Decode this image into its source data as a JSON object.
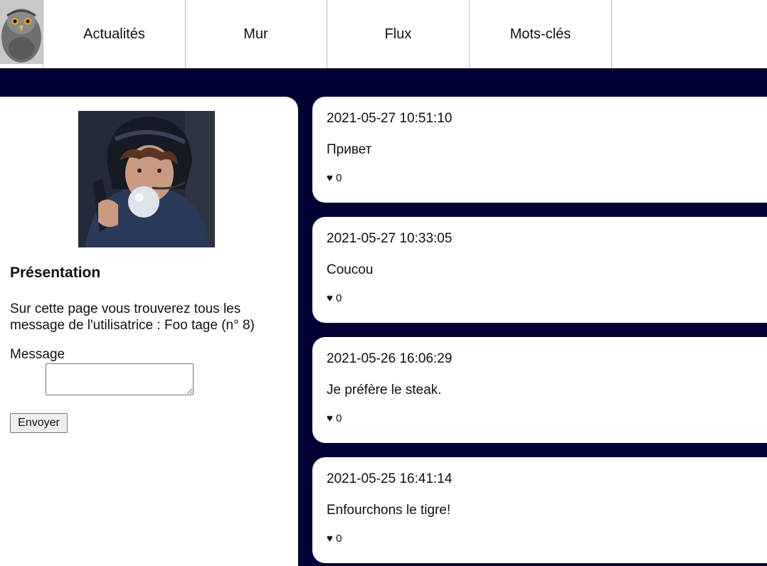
{
  "nav": {
    "items": [
      {
        "label": "Actualités"
      },
      {
        "label": "Mur"
      },
      {
        "label": "Flux"
      },
      {
        "label": "Mots-clés"
      }
    ]
  },
  "profile": {
    "title": "Présentation",
    "description": "Sur cette page vous trouverez tous les message de l'utilisatrice : Foo tage (n° 8)",
    "message_label": "Message",
    "message_value": "",
    "send_label": "Envoyer"
  },
  "posts": [
    {
      "date": "2021-05-27 10:51:10",
      "text": "Привет",
      "likes": "♥ 0"
    },
    {
      "date": "2021-05-27 10:33:05",
      "text": "Coucou",
      "likes": "♥ 0"
    },
    {
      "date": "2021-05-26 16:06:29",
      "text": "Je préfère le steak.",
      "likes": "♥ 0"
    },
    {
      "date": "2021-05-25 16:41:14",
      "text": "Enfourchons le tigre!",
      "likes": "♥ 0"
    }
  ],
  "colors": {
    "page_background": "#000033",
    "card_background": "#ffffff"
  }
}
